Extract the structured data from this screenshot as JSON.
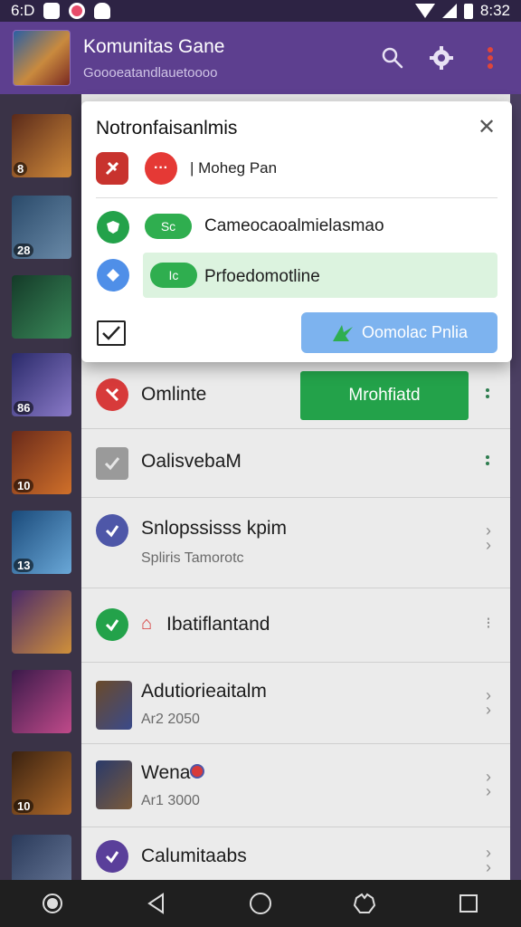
{
  "status_bar": {
    "time": "6:D",
    "right_time": "8:32"
  },
  "app_bar": {
    "title": "Komunitas Gane",
    "subtitle": "Goooeatandlauetoooo",
    "icons": [
      "search-icon",
      "gear-icon",
      "overflow-menu-icon"
    ]
  },
  "thumbs": [
    {
      "badge": "8",
      "colors": [
        "#5a2a1a",
        "#d08a3a"
      ]
    },
    {
      "badge": "28",
      "colors": [
        "#2a4a6a",
        "#6a8aa8"
      ]
    },
    {
      "badge": "",
      "colors": [
        "#143a28",
        "#3a8a5a"
      ]
    },
    {
      "badge": "86",
      "colors": [
        "#2a2a6a",
        "#8a7ac8"
      ]
    },
    {
      "badge": "10",
      "colors": [
        "#6a2a1a",
        "#d0702a"
      ]
    },
    {
      "badge": "13",
      "colors": [
        "#1a4a7a",
        "#6aa8d8"
      ]
    },
    {
      "badge": "",
      "colors": [
        "#4a2a6a",
        "#d0903a"
      ]
    },
    {
      "badge": "",
      "colors": [
        "#3a1a4a",
        "#c04a8a"
      ]
    },
    {
      "badge": "10",
      "colors": [
        "#3a2210",
        "#b06a2a"
      ]
    },
    {
      "badge": "",
      "colors": [
        "#2a3a5a",
        "#6a7a9a"
      ]
    }
  ],
  "dialog": {
    "title": "Notronfaisanlmis",
    "row1_label": "Moheg Pan",
    "option1_pill": "Sc",
    "option1_label": "Cameocaoalmielasmao",
    "option2_pill": "Ic",
    "option2_label": "Prfoedomotline",
    "action_button": "Oomolac Pnlia"
  },
  "list": {
    "row1": {
      "title": "Omlinte",
      "button": "Mrohfiatd"
    },
    "row2": {
      "title": "OalisvebaM"
    },
    "row3": {
      "title": "Snlopssisss kpim",
      "subtitle": "Spliris Tamorotc"
    },
    "row4": {
      "title": "Ibatiflantand"
    },
    "row5": {
      "title": "Adutiorieaitalm",
      "subtitle": "Ar2 2050"
    },
    "row6": {
      "title": "Wena",
      "subtitle": "Ar1 3000"
    },
    "row7": {
      "title": "Calumitaabs"
    }
  },
  "colors": {
    "app_bar": "#5d3f8f",
    "status_bar": "#2d2344",
    "accent_green": "#23a24a",
    "accent_blue": "#7db3ef",
    "accent_red": "#d73a3a"
  }
}
